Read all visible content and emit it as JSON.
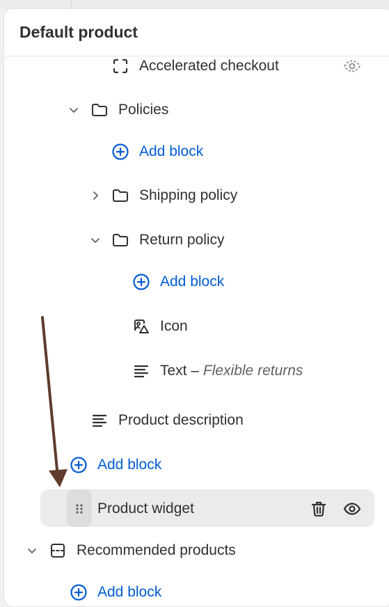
{
  "panel": {
    "title": "Default product"
  },
  "items": {
    "accelerated_checkout": {
      "label": "Accelerated checkout",
      "icon": "dashed-square-icon",
      "trailing_icon": "eye-hidden-icon"
    },
    "policies": {
      "label": "Policies",
      "icon": "folder-icon"
    },
    "policies_add_block": {
      "label": "Add block"
    },
    "shipping_policy": {
      "label": "Shipping policy",
      "icon": "folder-icon"
    },
    "return_policy": {
      "label": "Return policy",
      "icon": "folder-icon"
    },
    "return_add_block": {
      "label": "Add block"
    },
    "icon_block": {
      "label": "Icon",
      "icon": "image-icon"
    },
    "text_block": {
      "label": "Text",
      "separator": " – ",
      "detail": "Flexible returns",
      "icon": "text-lines-icon"
    },
    "product_description": {
      "label": "Product description",
      "icon": "text-lines-icon"
    },
    "product_add_block": {
      "label": "Add block"
    },
    "product_widget": {
      "label": "Product widget",
      "icon": "drag-handle-icon",
      "actions": [
        "trash-icon",
        "eye-icon"
      ]
    },
    "recommended_products": {
      "label": "Recommended products",
      "icon": "section-icon"
    },
    "recommended_add_block": {
      "label": "Add block"
    }
  },
  "colors": {
    "accent": "#005bd3",
    "text": "#303030",
    "muted": "#616161",
    "arrow": "#5e3b2c",
    "selected_bg": "#ebebeb"
  }
}
